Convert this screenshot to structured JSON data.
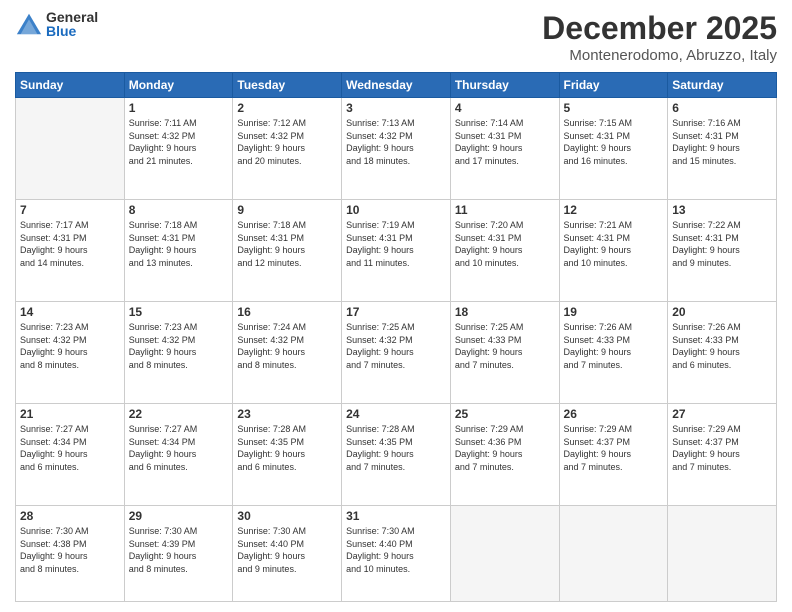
{
  "header": {
    "logo_general": "General",
    "logo_blue": "Blue",
    "month_year": "December 2025",
    "location": "Montenerodomo, Abruzzo, Italy"
  },
  "days_of_week": [
    "Sunday",
    "Monday",
    "Tuesday",
    "Wednesday",
    "Thursday",
    "Friday",
    "Saturday"
  ],
  "weeks": [
    [
      {
        "day": "",
        "info": ""
      },
      {
        "day": "1",
        "info": "Sunrise: 7:11 AM\nSunset: 4:32 PM\nDaylight: 9 hours\nand 21 minutes."
      },
      {
        "day": "2",
        "info": "Sunrise: 7:12 AM\nSunset: 4:32 PM\nDaylight: 9 hours\nand 20 minutes."
      },
      {
        "day": "3",
        "info": "Sunrise: 7:13 AM\nSunset: 4:32 PM\nDaylight: 9 hours\nand 18 minutes."
      },
      {
        "day": "4",
        "info": "Sunrise: 7:14 AM\nSunset: 4:31 PM\nDaylight: 9 hours\nand 17 minutes."
      },
      {
        "day": "5",
        "info": "Sunrise: 7:15 AM\nSunset: 4:31 PM\nDaylight: 9 hours\nand 16 minutes."
      },
      {
        "day": "6",
        "info": "Sunrise: 7:16 AM\nSunset: 4:31 PM\nDaylight: 9 hours\nand 15 minutes."
      }
    ],
    [
      {
        "day": "7",
        "info": "Sunrise: 7:17 AM\nSunset: 4:31 PM\nDaylight: 9 hours\nand 14 minutes."
      },
      {
        "day": "8",
        "info": "Sunrise: 7:18 AM\nSunset: 4:31 PM\nDaylight: 9 hours\nand 13 minutes."
      },
      {
        "day": "9",
        "info": "Sunrise: 7:18 AM\nSunset: 4:31 PM\nDaylight: 9 hours\nand 12 minutes."
      },
      {
        "day": "10",
        "info": "Sunrise: 7:19 AM\nSunset: 4:31 PM\nDaylight: 9 hours\nand 11 minutes."
      },
      {
        "day": "11",
        "info": "Sunrise: 7:20 AM\nSunset: 4:31 PM\nDaylight: 9 hours\nand 10 minutes."
      },
      {
        "day": "12",
        "info": "Sunrise: 7:21 AM\nSunset: 4:31 PM\nDaylight: 9 hours\nand 10 minutes."
      },
      {
        "day": "13",
        "info": "Sunrise: 7:22 AM\nSunset: 4:31 PM\nDaylight: 9 hours\nand 9 minutes."
      }
    ],
    [
      {
        "day": "14",
        "info": "Sunrise: 7:23 AM\nSunset: 4:32 PM\nDaylight: 9 hours\nand 8 minutes."
      },
      {
        "day": "15",
        "info": "Sunrise: 7:23 AM\nSunset: 4:32 PM\nDaylight: 9 hours\nand 8 minutes."
      },
      {
        "day": "16",
        "info": "Sunrise: 7:24 AM\nSunset: 4:32 PM\nDaylight: 9 hours\nand 8 minutes."
      },
      {
        "day": "17",
        "info": "Sunrise: 7:25 AM\nSunset: 4:32 PM\nDaylight: 9 hours\nand 7 minutes."
      },
      {
        "day": "18",
        "info": "Sunrise: 7:25 AM\nSunset: 4:33 PM\nDaylight: 9 hours\nand 7 minutes."
      },
      {
        "day": "19",
        "info": "Sunrise: 7:26 AM\nSunset: 4:33 PM\nDaylight: 9 hours\nand 7 minutes."
      },
      {
        "day": "20",
        "info": "Sunrise: 7:26 AM\nSunset: 4:33 PM\nDaylight: 9 hours\nand 6 minutes."
      }
    ],
    [
      {
        "day": "21",
        "info": "Sunrise: 7:27 AM\nSunset: 4:34 PM\nDaylight: 9 hours\nand 6 minutes."
      },
      {
        "day": "22",
        "info": "Sunrise: 7:27 AM\nSunset: 4:34 PM\nDaylight: 9 hours\nand 6 minutes."
      },
      {
        "day": "23",
        "info": "Sunrise: 7:28 AM\nSunset: 4:35 PM\nDaylight: 9 hours\nand 6 minutes."
      },
      {
        "day": "24",
        "info": "Sunrise: 7:28 AM\nSunset: 4:35 PM\nDaylight: 9 hours\nand 7 minutes."
      },
      {
        "day": "25",
        "info": "Sunrise: 7:29 AM\nSunset: 4:36 PM\nDaylight: 9 hours\nand 7 minutes."
      },
      {
        "day": "26",
        "info": "Sunrise: 7:29 AM\nSunset: 4:37 PM\nDaylight: 9 hours\nand 7 minutes."
      },
      {
        "day": "27",
        "info": "Sunrise: 7:29 AM\nSunset: 4:37 PM\nDaylight: 9 hours\nand 7 minutes."
      }
    ],
    [
      {
        "day": "28",
        "info": "Sunrise: 7:30 AM\nSunset: 4:38 PM\nDaylight: 9 hours\nand 8 minutes."
      },
      {
        "day": "29",
        "info": "Sunrise: 7:30 AM\nSunset: 4:39 PM\nDaylight: 9 hours\nand 8 minutes."
      },
      {
        "day": "30",
        "info": "Sunrise: 7:30 AM\nSunset: 4:40 PM\nDaylight: 9 hours\nand 9 minutes."
      },
      {
        "day": "31",
        "info": "Sunrise: 7:30 AM\nSunset: 4:40 PM\nDaylight: 9 hours\nand 10 minutes."
      },
      {
        "day": "",
        "info": ""
      },
      {
        "day": "",
        "info": ""
      },
      {
        "day": "",
        "info": ""
      }
    ]
  ]
}
